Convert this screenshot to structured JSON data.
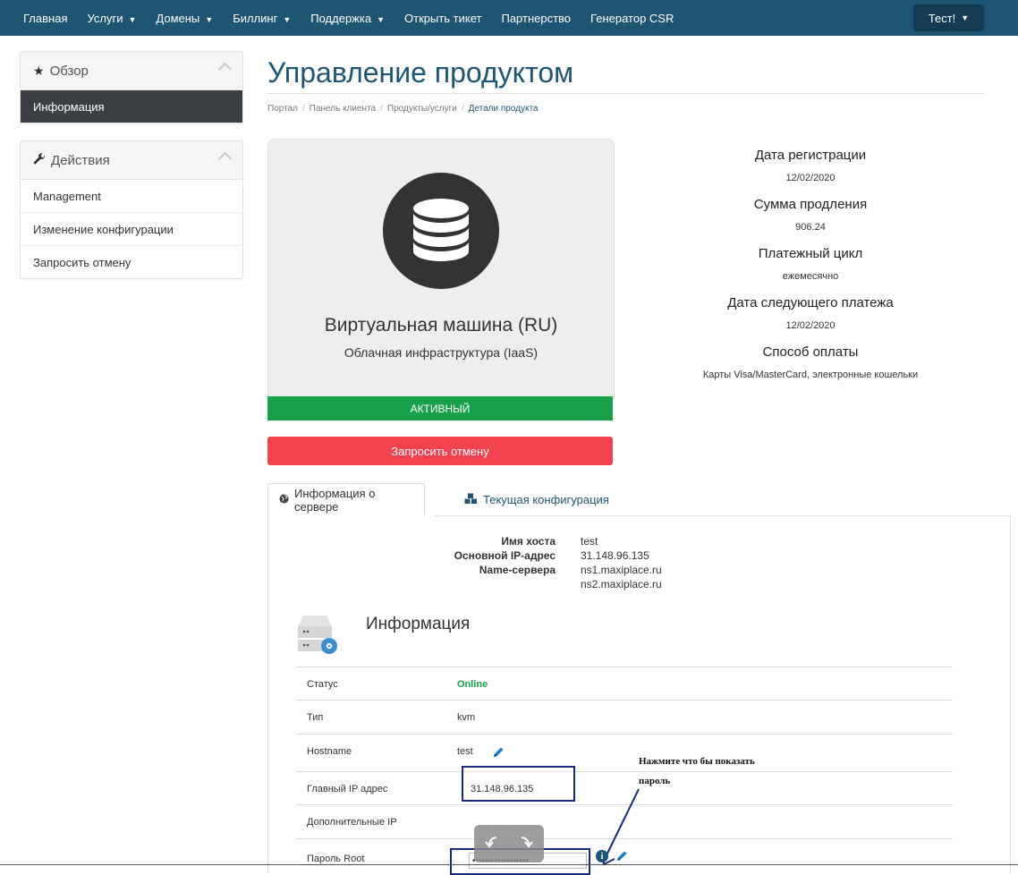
{
  "nav": {
    "items": [
      {
        "label": "Главная",
        "caret": false
      },
      {
        "label": "Услуги",
        "caret": true
      },
      {
        "label": "Домены",
        "caret": true
      },
      {
        "label": "Биллинг",
        "caret": true
      },
      {
        "label": "Поддержка",
        "caret": true
      },
      {
        "label": "Открыть тикет",
        "caret": false
      },
      {
        "label": "Партнерство",
        "caret": false
      },
      {
        "label": "Генератор CSR",
        "caret": false
      }
    ],
    "user": "Тест!",
    "caret_glyph": "▼"
  },
  "sidebar": {
    "overview": {
      "title": "Обзор",
      "icon": "star-icon",
      "items": [
        "Информация"
      ]
    },
    "actions": {
      "title": "Действия",
      "icon": "wrench-icon",
      "items": [
        "Management",
        "Изменение конфигурации",
        "Запросить отмену"
      ]
    }
  },
  "page": {
    "title": "Управление продуктом",
    "breadcrumb": [
      "Портал",
      "Панель клиента",
      "Продукты/услуги",
      "Детали продукта"
    ],
    "breadcrumb_sep": "/"
  },
  "product": {
    "name": "Виртуальная машина (RU)",
    "group": "Облачная инфраструктура (IaaS)",
    "status": "АКТИВНЫЙ",
    "cancel_label": "Запросить отмену",
    "icon": "database-icon"
  },
  "details": [
    {
      "label": "Дата регистрации",
      "value": "12/02/2020"
    },
    {
      "label": "Сумма продления",
      "value": "906.24"
    },
    {
      "label": "Платежный цикл",
      "value": "ежемесячно"
    },
    {
      "label": "Дата следующего платежа",
      "value": "12/02/2020"
    },
    {
      "label": "Способ оплаты",
      "value": "Карты Visa/MasterCard, электронные кошельки"
    }
  ],
  "tabs": {
    "server_info": "Информация о сервере",
    "config": "Текущая конфигурация"
  },
  "server": {
    "hostname_label": "Имя хоста",
    "hostname": "test",
    "ip_label": "Основной IP-адрес",
    "ip": "31.148.96.135",
    "ns_label": "Name-сервера",
    "ns1": "ns1.maxiplace.ru",
    "ns2": "ns2.maxiplace.ru"
  },
  "info_section": {
    "title": "Информация",
    "rows": [
      {
        "key": "Статус",
        "value": "Online"
      },
      {
        "key": "Тип",
        "value": "kvm"
      },
      {
        "key": "Hostname",
        "value": "test"
      },
      {
        "key": "Главный IP адрес",
        "value": "31.148.96.135"
      },
      {
        "key": "Дополнительные IP",
        "value": ""
      },
      {
        "key": "Пароль Root",
        "value": "••••••••••••••••••"
      }
    ]
  },
  "annotation": {
    "line1": "Нажмите что бы показать",
    "line2": "пароль"
  },
  "colors": {
    "nav_bg": "#1e5573",
    "active_sidebar": "#3b3f44",
    "status_green": "#18a04a",
    "cancel_red": "#f0424f",
    "annotation_blue": "#1a2a7a"
  }
}
